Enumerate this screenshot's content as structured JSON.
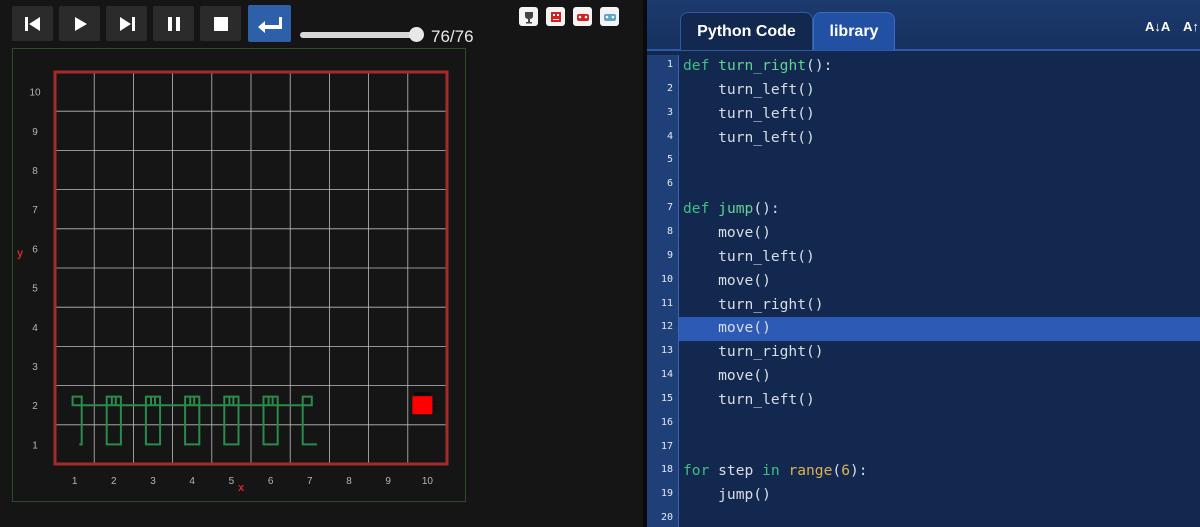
{
  "controls": [
    {
      "name": "reset",
      "icon": "skip-to-start-icon"
    },
    {
      "name": "play",
      "icon": "play-icon"
    },
    {
      "name": "step",
      "icon": "step-forward-icon"
    },
    {
      "name": "pause",
      "icon": "pause-icon"
    },
    {
      "name": "stop",
      "icon": "stop-icon"
    },
    {
      "name": "return",
      "icon": "return-arrow-icon"
    }
  ],
  "slider": {
    "value": 76,
    "max": 76,
    "fraction": 1.0,
    "label": "76/76"
  },
  "tool_icons": [
    "trophy-icon",
    "robot-icon",
    "robot-red-icon",
    "robot-blue-icon"
  ],
  "world": {
    "x_ticks": [
      "1",
      "2",
      "3",
      "4",
      "5",
      "6",
      "7",
      "8",
      "9",
      "10"
    ],
    "y_ticks": [
      "1",
      "2",
      "3",
      "4",
      "5",
      "6",
      "7",
      "8",
      "9",
      "10"
    ],
    "x_label": "x",
    "y_label": "y",
    "robot": {
      "x": 10,
      "y": 2,
      "label": "E",
      "color": "#ff0000"
    },
    "trace_color": "#2a8c4c",
    "wall_color": "#a52a2a"
  },
  "editor": {
    "tabs": [
      {
        "label": "Python Code",
        "active": true
      },
      {
        "label": "library",
        "active": false
      }
    ],
    "font_buttons": [
      "A↓A",
      "A↑"
    ],
    "highlight_line": 12,
    "lines": [
      "def turn_right():",
      "    turn_left()",
      "    turn_left()",
      "    turn_left()",
      "",
      "",
      "def jump():",
      "    move()",
      "    turn_left()",
      "    move()",
      "    turn_right()",
      "    move()",
      "    turn_right()",
      "    move()",
      "    turn_left()",
      "",
      "",
      "for step in range(6):",
      "    jump()",
      ""
    ]
  }
}
